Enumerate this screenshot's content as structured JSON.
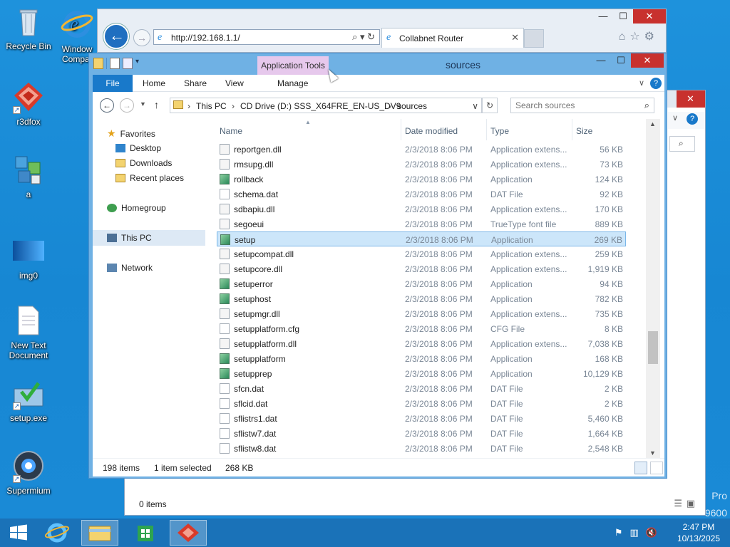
{
  "desktop": {
    "icons": [
      {
        "label": "Recycle Bin",
        "icon": "recycle-bin-icon"
      },
      {
        "label": "Window Compat",
        "icon": "ie-icon"
      },
      {
        "label": "r3dfox",
        "icon": "r3dfox-icon"
      },
      {
        "label": "a",
        "icon": "registry-icon"
      },
      {
        "label": "img0",
        "icon": "image-icon"
      },
      {
        "label": "New Text Document",
        "icon": "text-document-icon"
      },
      {
        "label": "setup.exe",
        "icon": "setup-icon"
      },
      {
        "label": "Supermium",
        "icon": "supermium-icon"
      }
    ],
    "watermark_line1": "Pro",
    "watermark_line2": "9600"
  },
  "ie_window": {
    "url": "http://192.168.1.1/",
    "tab_title": "Collabnet Router",
    "address_icons": "⌕ ▾ ↻"
  },
  "explorer": {
    "title": "sources",
    "app_tools": "Application Tools",
    "ribbon_tabs": [
      "File",
      "Home",
      "Share",
      "View",
      "Manage"
    ],
    "breadcrumb": [
      "This PC",
      "CD Drive (D:) SSS_X64FRE_EN-US_DV9",
      "sources"
    ],
    "search_placeholder": "Search sources",
    "nav": {
      "favorites": "Favorites",
      "desktop": "Desktop",
      "downloads": "Downloads",
      "recent": "Recent places",
      "homegroup": "Homegroup",
      "thispc": "This PC",
      "network": "Network"
    },
    "columns": [
      "Name",
      "Date modified",
      "Type",
      "Size"
    ],
    "files": [
      {
        "name": "reportgen.dll",
        "date": "2/3/2018 8:06 PM",
        "type": "Application extens...",
        "size": "56 KB",
        "icon": "dll"
      },
      {
        "name": "rmsupg.dll",
        "date": "2/3/2018 8:06 PM",
        "type": "Application extens...",
        "size": "73 KB",
        "icon": "dll"
      },
      {
        "name": "rollback",
        "date": "2/3/2018 8:06 PM",
        "type": "Application",
        "size": "124 KB",
        "icon": "app"
      },
      {
        "name": "schema.dat",
        "date": "2/3/2018 8:06 PM",
        "type": "DAT File",
        "size": "92 KB",
        "icon": "dat"
      },
      {
        "name": "sdbapiu.dll",
        "date": "2/3/2018 8:06 PM",
        "type": "Application extens...",
        "size": "170 KB",
        "icon": "dll"
      },
      {
        "name": "segoeui",
        "date": "2/3/2018 8:06 PM",
        "type": "TrueType font file",
        "size": "889 KB",
        "icon": "font"
      },
      {
        "name": "setup",
        "date": "2/3/2018 8:06 PM",
        "type": "Application",
        "size": "269 KB",
        "icon": "app",
        "selected": true
      },
      {
        "name": "setupcompat.dll",
        "date": "2/3/2018 8:06 PM",
        "type": "Application extens...",
        "size": "259 KB",
        "icon": "dll"
      },
      {
        "name": "setupcore.dll",
        "date": "2/3/2018 8:06 PM",
        "type": "Application extens...",
        "size": "1,919 KB",
        "icon": "dll"
      },
      {
        "name": "setuperror",
        "date": "2/3/2018 8:06 PM",
        "type": "Application",
        "size": "94 KB",
        "icon": "app"
      },
      {
        "name": "setuphost",
        "date": "2/3/2018 8:06 PM",
        "type": "Application",
        "size": "782 KB",
        "icon": "app"
      },
      {
        "name": "setupmgr.dll",
        "date": "2/3/2018 8:06 PM",
        "type": "Application extens...",
        "size": "735 KB",
        "icon": "dll"
      },
      {
        "name": "setupplatform.cfg",
        "date": "2/3/2018 8:06 PM",
        "type": "CFG File",
        "size": "8 KB",
        "icon": "dat"
      },
      {
        "name": "setupplatform.dll",
        "date": "2/3/2018 8:06 PM",
        "type": "Application extens...",
        "size": "7,038 KB",
        "icon": "dll"
      },
      {
        "name": "setupplatform",
        "date": "2/3/2018 8:06 PM",
        "type": "Application",
        "size": "168 KB",
        "icon": "app"
      },
      {
        "name": "setupprep",
        "date": "2/3/2018 8:06 PM",
        "type": "Application",
        "size": "10,129 KB",
        "icon": "app"
      },
      {
        "name": "sfcn.dat",
        "date": "2/3/2018 8:06 PM",
        "type": "DAT File",
        "size": "2 KB",
        "icon": "dat"
      },
      {
        "name": "sflcid.dat",
        "date": "2/3/2018 8:06 PM",
        "type": "DAT File",
        "size": "2 KB",
        "icon": "dat"
      },
      {
        "name": "sflistrs1.dat",
        "date": "2/3/2018 8:06 PM",
        "type": "DAT File",
        "size": "5,460 KB",
        "icon": "dat"
      },
      {
        "name": "sflistw7.dat",
        "date": "2/3/2018 8:06 PM",
        "type": "DAT File",
        "size": "1,664 KB",
        "icon": "dat"
      },
      {
        "name": "sflistw8.dat",
        "date": "2/3/2018 8:06 PM",
        "type": "DAT File",
        "size": "2,548 KB",
        "icon": "dat"
      }
    ],
    "status_count": "198 items",
    "status_selected": "1 item selected",
    "status_size": "268 KB"
  },
  "bg_explorer": {
    "status": "0 items"
  },
  "taskbar": {
    "time": "2:47 PM",
    "date": "10/13/2025",
    "apps": [
      "ie-icon",
      "file-explorer-icon",
      "store-icon",
      "r3dfox-icon"
    ]
  },
  "colors": {
    "accent": "#1979ca",
    "selection": "#cce6fa",
    "close": "#c8312e",
    "app_tools": "#e6c8ec"
  }
}
